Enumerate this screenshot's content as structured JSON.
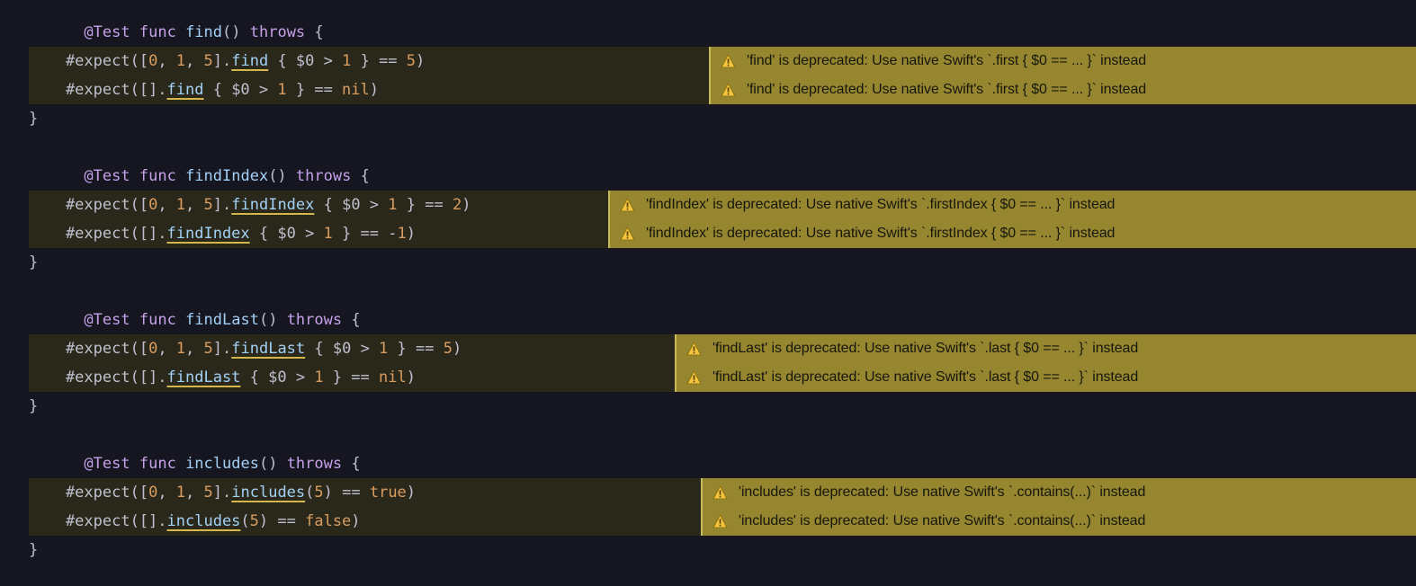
{
  "code": {
    "find": {
      "sig": {
        "at": "@Test",
        "func": "func",
        "name": "find",
        "parens": "()",
        "throws": "throws",
        "brace": " {"
      },
      "l1": {
        "pre": "    #expect([",
        "a0": "0",
        "c1": ", ",
        "a1": "1",
        "c2": ", ",
        "a2": "5",
        "br": "].",
        "m": "find",
        "blk": " { $0 > ",
        "arg": "1",
        "blk2": " } == ",
        "res": "5",
        "end": ")"
      },
      "l2": {
        "pre": "    #expect([].",
        "m": "find",
        "blk": " { $0 > ",
        "arg": "1",
        "blk2": " } == ",
        "res": "nil",
        "end": ")"
      },
      "close": "}"
    },
    "findIndex": {
      "sig": {
        "at": "@Test",
        "func": "func",
        "name": "findIndex",
        "parens": "()",
        "throws": "throws",
        "brace": " {"
      },
      "l1": {
        "pre": "    #expect([",
        "a0": "0",
        "c1": ", ",
        "a1": "1",
        "c2": ", ",
        "a2": "5",
        "br": "].",
        "m": "findIndex",
        "blk": " { $0 > ",
        "arg": "1",
        "blk2": " } == ",
        "res": "2",
        "end": ")"
      },
      "l2": {
        "pre": "    #expect([].",
        "m": "findIndex",
        "blk": " { $0 > ",
        "arg": "1",
        "blk2": " } == -",
        "res": "1",
        "end": ")"
      },
      "close": "}"
    },
    "findLast": {
      "sig": {
        "at": "@Test",
        "func": "func",
        "name": "findLast",
        "parens": "()",
        "throws": "throws",
        "brace": " {"
      },
      "l1": {
        "pre": "    #expect([",
        "a0": "0",
        "c1": ", ",
        "a1": "1",
        "c2": ", ",
        "a2": "5",
        "br": "].",
        "m": "findLast",
        "blk": " { $0 > ",
        "arg": "1",
        "blk2": " } == ",
        "res": "5",
        "end": ")"
      },
      "l2": {
        "pre": "    #expect([].",
        "m": "findLast",
        "blk": " { $0 > ",
        "arg": "1",
        "blk2": " } == ",
        "res": "nil",
        "end": ")"
      },
      "close": "}"
    },
    "includes": {
      "sig": {
        "at": "@Test",
        "func": "func",
        "name": "includes",
        "parens": "()",
        "throws": "throws",
        "brace": " {"
      },
      "l1": {
        "pre": "    #expect([",
        "a0": "0",
        "c1": ", ",
        "a1": "1",
        "c2": ", ",
        "a2": "5",
        "br": "].",
        "m": "includes",
        "call": "(",
        "arg": "5",
        "call2": ") == ",
        "res": "true",
        "end": ")"
      },
      "l2": {
        "pre": "    #expect([].",
        "m": "includes",
        "call": "(",
        "arg": "5",
        "call2": ") == ",
        "res": "false",
        "end": ")"
      },
      "close": "}"
    }
  },
  "warnings": {
    "find": "'find' is deprecated: Use native Swift's `.first { $0 == ... }` instead",
    "findIndex": "'findIndex' is deprecated: Use native Swift's `.firstIndex { $0 == ... }` instead",
    "findLast": "'findLast' is deprecated: Use native Swift's `.last { $0 == ... }` instead",
    "includes": "'includes' is deprecated: Use native Swift's `.contains(...)` instead"
  }
}
